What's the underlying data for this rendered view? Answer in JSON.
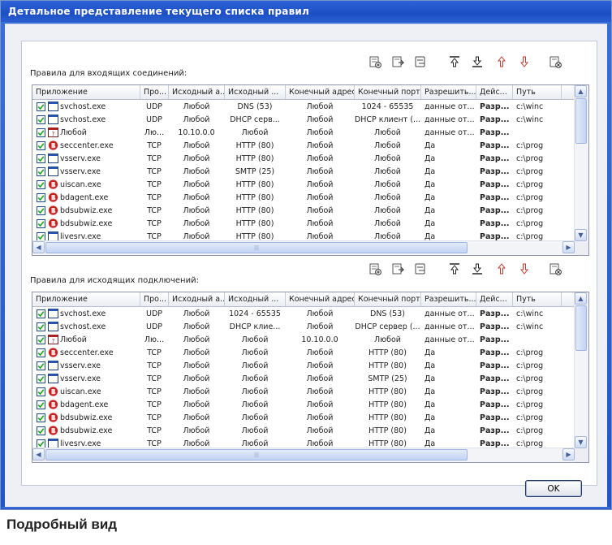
{
  "window": {
    "title": "Детальное представление текущего списка правил"
  },
  "caption": "Подробный вид",
  "ok_label": "OK",
  "toolbar_icons": [
    "add-rule-icon",
    "edit-rule-icon",
    "delete-rule-icon",
    "move-top-icon",
    "move-bottom-icon",
    "move-up-icon",
    "move-down-icon",
    "reset-icon"
  ],
  "columns": [
    "Приложение",
    "Про...",
    "Исходный а...",
    "Исходный ...",
    "Конечный адрес",
    "Конечный порт",
    "Разрешить...",
    "Дейс...",
    "Путь"
  ],
  "inbound": {
    "label": "Правила для входящих соединений:",
    "rows": [
      {
        "app": "svchost.exe",
        "icon": "window-app-icon",
        "proto": "UDP",
        "src_addr": "Любой",
        "src_port": "DNS (53)",
        "dst_addr": "Любой",
        "dst_port": "1024 - 65535",
        "allow": "данные от...",
        "action": "Разр...",
        "path": "c:\\winc"
      },
      {
        "app": "svchost.exe",
        "icon": "window-app-icon",
        "proto": "UDP",
        "src_addr": "Любой",
        "src_port": "DHCP серв...",
        "dst_addr": "Любой",
        "dst_port": "DHCP клиент (...",
        "allow": "данные от...",
        "action": "Разр...",
        "path": "c:\\winc"
      },
      {
        "app": "Любой",
        "icon": "any-app-icon",
        "proto": "Лю...",
        "src_addr": "10.10.0.0",
        "src_port": "Любой",
        "dst_addr": "Любой",
        "dst_port": "Любой",
        "allow": "данные от...",
        "action": "Разр...",
        "path": ""
      },
      {
        "app": "seccenter.exe",
        "icon": "bitdefender-icon",
        "proto": "TCP",
        "src_addr": "Любой",
        "src_port": "HTTP (80)",
        "dst_addr": "Любой",
        "dst_port": "Любой",
        "allow": "Да",
        "action": "Разр...",
        "path": "c:\\prog"
      },
      {
        "app": "vsserv.exe",
        "icon": "window-app-icon",
        "proto": "TCP",
        "src_addr": "Любой",
        "src_port": "HTTP (80)",
        "dst_addr": "Любой",
        "dst_port": "Любой",
        "allow": "Да",
        "action": "Разр...",
        "path": "c:\\prog"
      },
      {
        "app": "vsserv.exe",
        "icon": "window-app-icon",
        "proto": "TCP",
        "src_addr": "Любой",
        "src_port": "SMTP (25)",
        "dst_addr": "Любой",
        "dst_port": "Любой",
        "allow": "Да",
        "action": "Разр...",
        "path": "c:\\prog"
      },
      {
        "app": "uiscan.exe",
        "icon": "bitdefender-icon",
        "proto": "TCP",
        "src_addr": "Любой",
        "src_port": "HTTP (80)",
        "dst_addr": "Любой",
        "dst_port": "Любой",
        "allow": "Да",
        "action": "Разр...",
        "path": "c:\\prog"
      },
      {
        "app": "bdagent.exe",
        "icon": "bitdefender-icon",
        "proto": "TCP",
        "src_addr": "Любой",
        "src_port": "HTTP (80)",
        "dst_addr": "Любой",
        "dst_port": "Любой",
        "allow": "Да",
        "action": "Разр...",
        "path": "c:\\prog"
      },
      {
        "app": "bdsubwiz.exe",
        "icon": "bitdefender-icon",
        "proto": "TCP",
        "src_addr": "Любой",
        "src_port": "HTTP (80)",
        "dst_addr": "Любой",
        "dst_port": "Любой",
        "allow": "Да",
        "action": "Разр...",
        "path": "c:\\prog"
      },
      {
        "app": "bdsubwiz.exe",
        "icon": "bitdefender-icon",
        "proto": "TCP",
        "src_addr": "Любой",
        "src_port": "HTTP (80)",
        "dst_addr": "Любой",
        "dst_port": "Любой",
        "allow": "Да",
        "action": "Разр...",
        "path": "c:\\prog"
      },
      {
        "app": "livesrv.exe",
        "icon": "window-app-icon",
        "proto": "TCP",
        "src_addr": "Любой",
        "src_port": "HTTP (80)",
        "dst_addr": "Любой",
        "dst_port": "Любой",
        "allow": "Да",
        "action": "Разр...",
        "path": "c:\\prog"
      }
    ]
  },
  "outbound": {
    "label": "Правила для исходящих подключений:",
    "rows": [
      {
        "app": "svchost.exe",
        "icon": "window-app-icon",
        "proto": "UDP",
        "src_addr": "Любой",
        "src_port": "1024 - 65535",
        "dst_addr": "Любой",
        "dst_port": "DNS (53)",
        "allow": "данные от...",
        "action": "Разр...",
        "path": "c:\\winc"
      },
      {
        "app": "svchost.exe",
        "icon": "window-app-icon",
        "proto": "UDP",
        "src_addr": "Любой",
        "src_port": "DHCP клие...",
        "dst_addr": "Любой",
        "dst_port": "DHCP сервер (...",
        "allow": "данные от...",
        "action": "Разр...",
        "path": "c:\\winc"
      },
      {
        "app": "Любой",
        "icon": "any-app-icon",
        "proto": "Лю...",
        "src_addr": "Любой",
        "src_port": "Любой",
        "dst_addr": "10.10.0.0",
        "dst_port": "Любой",
        "allow": "данные от...",
        "action": "Разр...",
        "path": ""
      },
      {
        "app": "seccenter.exe",
        "icon": "bitdefender-icon",
        "proto": "TCP",
        "src_addr": "Любой",
        "src_port": "Любой",
        "dst_addr": "Любой",
        "dst_port": "HTTP (80)",
        "allow": "Да",
        "action": "Разр...",
        "path": "c:\\prog"
      },
      {
        "app": "vsserv.exe",
        "icon": "window-app-icon",
        "proto": "TCP",
        "src_addr": "Любой",
        "src_port": "Любой",
        "dst_addr": "Любой",
        "dst_port": "HTTP (80)",
        "allow": "Да",
        "action": "Разр...",
        "path": "c:\\prog"
      },
      {
        "app": "vsserv.exe",
        "icon": "window-app-icon",
        "proto": "TCP",
        "src_addr": "Любой",
        "src_port": "Любой",
        "dst_addr": "Любой",
        "dst_port": "SMTP (25)",
        "allow": "Да",
        "action": "Разр...",
        "path": "c:\\prog"
      },
      {
        "app": "uiscan.exe",
        "icon": "bitdefender-icon",
        "proto": "TCP",
        "src_addr": "Любой",
        "src_port": "Любой",
        "dst_addr": "Любой",
        "dst_port": "HTTP (80)",
        "allow": "Да",
        "action": "Разр...",
        "path": "c:\\prog"
      },
      {
        "app": "bdagent.exe",
        "icon": "bitdefender-icon",
        "proto": "TCP",
        "src_addr": "Любой",
        "src_port": "Любой",
        "dst_addr": "Любой",
        "dst_port": "HTTP (80)",
        "allow": "Да",
        "action": "Разр...",
        "path": "c:\\prog"
      },
      {
        "app": "bdsubwiz.exe",
        "icon": "bitdefender-icon",
        "proto": "TCP",
        "src_addr": "Любой",
        "src_port": "Любой",
        "dst_addr": "Любой",
        "dst_port": "HTTP (80)",
        "allow": "Да",
        "action": "Разр...",
        "path": "c:\\prog"
      },
      {
        "app": "bdsubwiz.exe",
        "icon": "bitdefender-icon",
        "proto": "TCP",
        "src_addr": "Любой",
        "src_port": "Любой",
        "dst_addr": "Любой",
        "dst_port": "HTTP (80)",
        "allow": "Да",
        "action": "Разр...",
        "path": "c:\\prog"
      },
      {
        "app": "livesrv.exe",
        "icon": "window-app-icon",
        "proto": "TCP",
        "src_addr": "Любой",
        "src_port": "Любой",
        "dst_addr": "Любой",
        "dst_port": "HTTP (80)",
        "allow": "Да",
        "action": "Разр...",
        "path": "c:\\prog"
      }
    ]
  }
}
